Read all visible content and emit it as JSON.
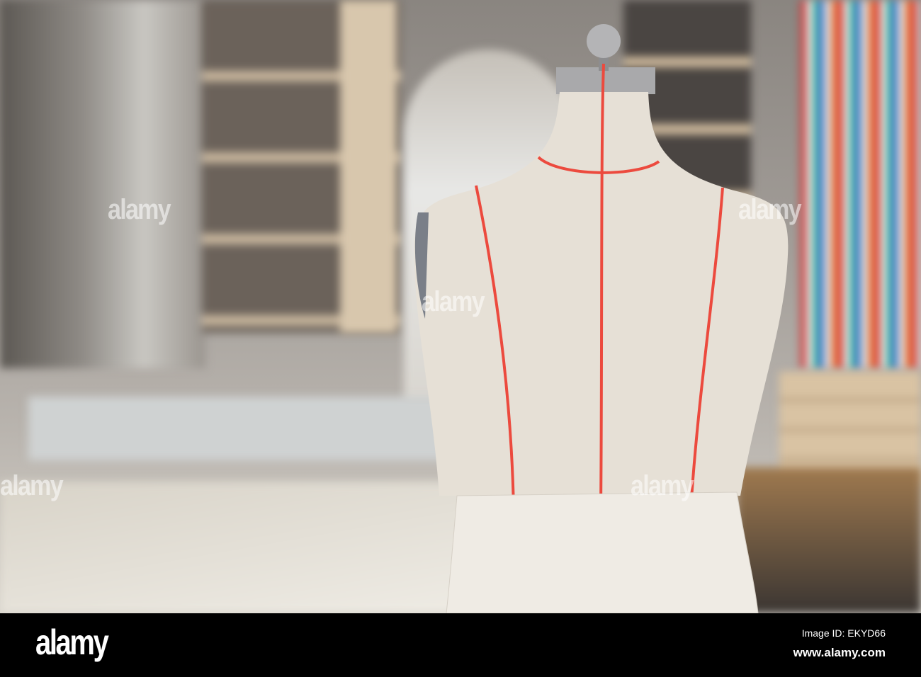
{
  "watermark": {
    "text": "alamy"
  },
  "footer": {
    "logo": "alamy",
    "image_id": "Image ID: EKYD66",
    "url": "www.alamy.com"
  }
}
